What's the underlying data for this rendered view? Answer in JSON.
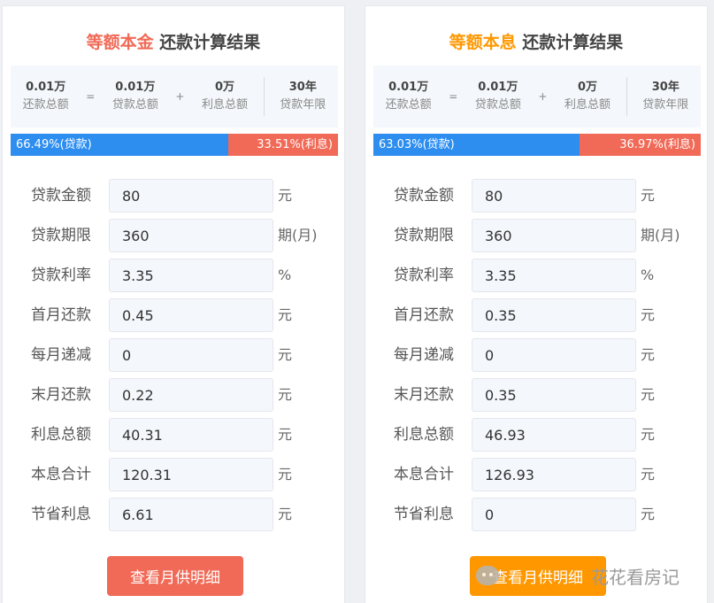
{
  "colors": {
    "equal_principal_accent": "#f06a57",
    "equal_installment_accent": "#ff9800",
    "loan_bar": "#2d8ef0",
    "interest_bar": "#f06a57"
  },
  "panels": [
    {
      "title_highlight": "等额本金",
      "title_rest": " 还款计算结果",
      "summary": {
        "total_value": "0.01万",
        "total_label": "还款总额",
        "eq": "=",
        "loan_value": "0.01万",
        "loan_label": "贷款总额",
        "plus": "+",
        "interest_value": "0万",
        "interest_label": "利息总额",
        "years_value": "30年",
        "years_label": "贷款年限"
      },
      "ratio": {
        "loan_text": "66.49%(贷款)",
        "interest_text": "33.51%(利息)",
        "loan_fraction": 0.6649
      },
      "fields": [
        {
          "label": "贷款金额",
          "value": "80",
          "unit": "元"
        },
        {
          "label": "贷款期限",
          "value": "360",
          "unit": "期(月)"
        },
        {
          "label": "贷款利率",
          "value": "3.35",
          "unit": "%"
        },
        {
          "label": "首月还款",
          "value": "0.45",
          "unit": "元"
        },
        {
          "label": "每月递减",
          "value": "0",
          "unit": "元"
        },
        {
          "label": "末月还款",
          "value": "0.22",
          "unit": "元"
        },
        {
          "label": "利息总额",
          "value": "40.31",
          "unit": "元"
        },
        {
          "label": "本息合计",
          "value": "120.31",
          "unit": "元"
        },
        {
          "label": "节省利息",
          "value": "6.61",
          "unit": "元"
        }
      ],
      "button_label": "查看月供明细"
    },
    {
      "title_highlight": "等额本息",
      "title_rest": " 还款计算结果",
      "summary": {
        "total_value": "0.01万",
        "total_label": "还款总额",
        "eq": "=",
        "loan_value": "0.01万",
        "loan_label": "贷款总额",
        "plus": "+",
        "interest_value": "0万",
        "interest_label": "利息总额",
        "years_value": "30年",
        "years_label": "贷款年限"
      },
      "ratio": {
        "loan_text": "63.03%(贷款)",
        "interest_text": "36.97%(利息)",
        "loan_fraction": 0.6303
      },
      "fields": [
        {
          "label": "贷款金额",
          "value": "80",
          "unit": "元"
        },
        {
          "label": "贷款期限",
          "value": "360",
          "unit": "期(月)"
        },
        {
          "label": "贷款利率",
          "value": "3.35",
          "unit": "%"
        },
        {
          "label": "首月还款",
          "value": "0.35",
          "unit": "元"
        },
        {
          "label": "每月递减",
          "value": "0",
          "unit": "元"
        },
        {
          "label": "末月还款",
          "value": "0.35",
          "unit": "元"
        },
        {
          "label": "利息总额",
          "value": "46.93",
          "unit": "元"
        },
        {
          "label": "本息合计",
          "value": "126.93",
          "unit": "元"
        },
        {
          "label": "节省利息",
          "value": "0",
          "unit": "元"
        }
      ],
      "button_label": "查看月供明细"
    }
  ],
  "watermark": {
    "text": "花花看房记",
    "icon": "wechat-icon"
  }
}
